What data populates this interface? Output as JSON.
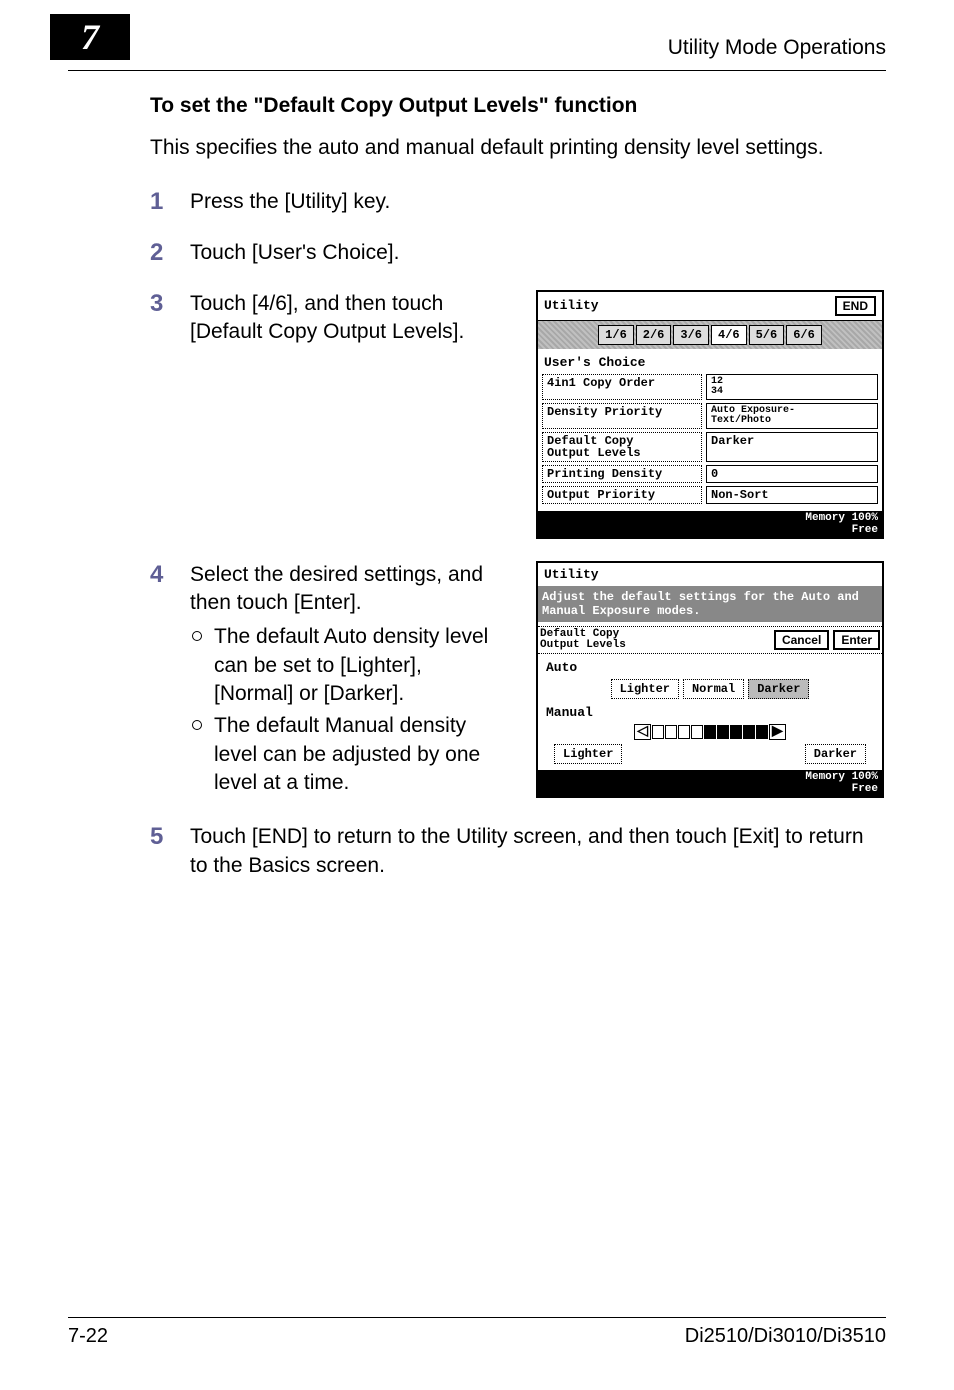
{
  "header": {
    "chapter_num": "7",
    "right_text": "Utility Mode Operations"
  },
  "section": {
    "title": "To set the \"Default Copy Output Levels\" function",
    "intro": "This specifies the auto and manual default printing density level settings."
  },
  "steps": {
    "s1": {
      "num": "1",
      "text": "Press the [Utility] key."
    },
    "s2": {
      "num": "2",
      "text": "Touch [User's Choice]."
    },
    "s3": {
      "num": "3",
      "text": "Touch [4/6], and then touch [Default Copy Output Levels]."
    },
    "s4": {
      "num": "4",
      "text": "Select the desired settings, and then touch [Enter].",
      "b1": "The default Auto density level can be set to [Lighter], [Normal] or [Darker].",
      "b2": "The default Manual density level can be adjusted by one level at a time."
    },
    "s5": {
      "num": "5",
      "text": "Touch [END] to return to the Utility screen, and then touch [Exit] to return to the Basics screen."
    }
  },
  "screen1": {
    "title": "Utility",
    "end": "END",
    "tabs": {
      "t1": "1/6",
      "t2": "2/6",
      "t3": "3/6",
      "t4": "4/6",
      "t5": "5/6",
      "t6": "6/6"
    },
    "subtitle": "User's Choice",
    "rows": {
      "r1": {
        "label": "4in1 Copy Order",
        "value": "12\n34"
      },
      "r2": {
        "label": "Density Priority",
        "value": "Auto Exposure-\nText/Photo"
      },
      "r3": {
        "label": "Default Copy\nOutput Levels",
        "value": "Darker"
      },
      "r4": {
        "label": "Printing Density",
        "value": "0"
      },
      "r5": {
        "label": "Output Priority",
        "value": "Non-Sort"
      }
    },
    "footer": "Memory 100%\nFree"
  },
  "screen2": {
    "title": "Utility",
    "message": "Adjust the default settings for the Auto and Manual Exposure modes.",
    "control": {
      "label": "Default Copy\nOutput Levels",
      "cancel": "Cancel",
      "enter": "Enter"
    },
    "auto": {
      "title": "Auto",
      "opt1": "Lighter",
      "opt2": "Normal",
      "opt3": "Darker"
    },
    "manual": {
      "title": "Manual",
      "lighter": "Lighter",
      "darker": "Darker"
    },
    "footer": "Memory 100%\nFree"
  },
  "footer": {
    "left": "7-22",
    "right": "Di2510/Di3010/Di3510"
  }
}
